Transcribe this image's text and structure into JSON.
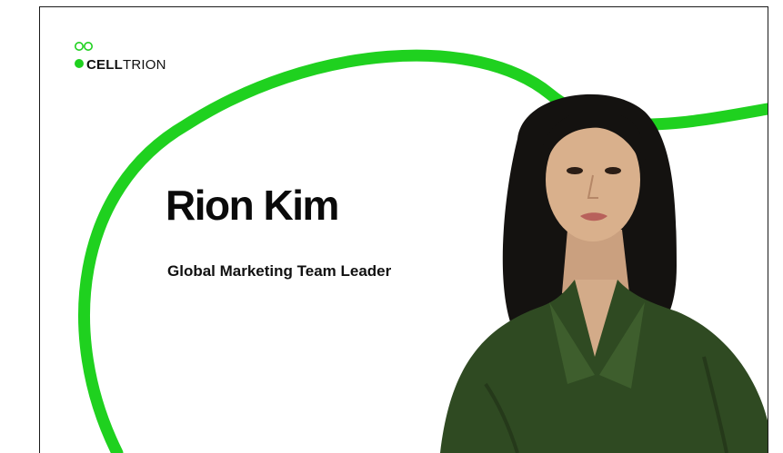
{
  "brand": {
    "name_bold": "CELL",
    "name_light": "TRION",
    "accent_color": "#1fd11f"
  },
  "card": {
    "name": "Rion Kim",
    "role": "Global Marketing Team Leader"
  },
  "photo": {
    "subject": "portrait-woman-green-satin-shirt"
  }
}
